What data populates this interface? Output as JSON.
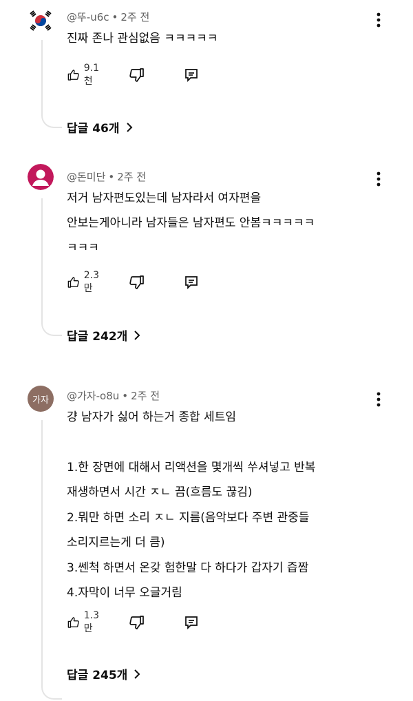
{
  "comments": [
    {
      "avatar_icon": "korea-flag-avatar-icon",
      "author": "@뚜-u6c",
      "separator": "•",
      "time": "2주 전",
      "lines": [
        "진짜 존나 관심없음 ㅋㅋㅋㅋㅋ"
      ],
      "likes": "9.1천",
      "replies_label": "답글 46개"
    },
    {
      "avatar_icon": "default-person-avatar-icon",
      "avatar_color": "#c2185b",
      "author": "@돈미단",
      "separator": "•",
      "time": "2주 전",
      "lines": [
        "저거 남자편도있는데 남자라서 여자편을",
        "안보는게아니라 남자들은 남자편도 안봄ㅋㅋㅋㅋㅋ",
        "ㅋㅋㅋ"
      ],
      "likes": "2.3만",
      "replies_label": "답글 242개"
    },
    {
      "avatar_text": "가자",
      "avatar_color": "#8d6e63",
      "author": "@가자-o8u",
      "separator": "•",
      "time": "2주 전",
      "lines": [
        "걍 남자가 싫어 하는거 종합 세트임",
        "",
        "1.한 장면에 대해서 리액션을 몇개씩 쑤셔넣고 반복",
        "재생하면서 시간 ㅈㄴ 끔(흐름도 끊김)",
        "2.뭐만 하면 소리 ㅈㄴ 지름(음악보다 주변 관중들",
        "소리지르는게 더 큼)",
        "3.쎈척 하면서 온갖 험한말 다 하다가 갑자기 즙짬",
        "4.자막이 너무 오글거림"
      ],
      "likes": "1.3만",
      "replies_label": "답글 245개"
    }
  ],
  "icons": {
    "like": "thumbs-up-icon",
    "dislike": "thumbs-down-icon",
    "reply": "reply-icon",
    "more": "more-vert-icon",
    "chevron": "chevron-right-icon"
  }
}
